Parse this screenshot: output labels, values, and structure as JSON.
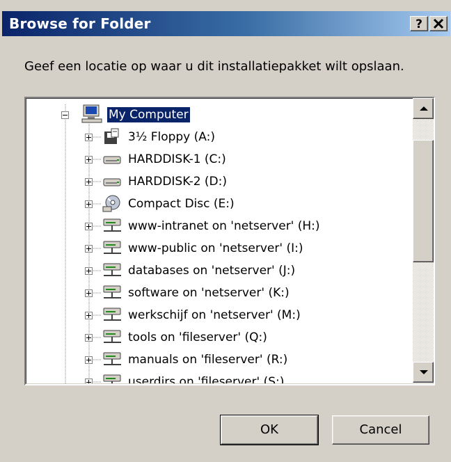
{
  "window": {
    "title": "Browse for Folder",
    "help_label": "?",
    "close_label": "close"
  },
  "instruction": "Geef een locatie op waar u dit installatiepakket wilt opslaan.",
  "tree": {
    "root": {
      "label": "My Computer",
      "icon": "my-computer-icon",
      "expanded": true,
      "selected": true
    },
    "items": [
      {
        "label": "3½ Floppy (A:)",
        "icon": "floppy-icon"
      },
      {
        "label": "HARDDISK-1 (C:)",
        "icon": "hard-drive-icon"
      },
      {
        "label": "HARDDISK-2 (D:)",
        "icon": "hard-drive-icon"
      },
      {
        "label": "Compact Disc (E:)",
        "icon": "cd-drive-icon"
      },
      {
        "label": "www-intranet on 'netserver' (H:)",
        "icon": "network-drive-icon"
      },
      {
        "label": "www-public on 'netserver' (I:)",
        "icon": "network-drive-icon"
      },
      {
        "label": "databases on 'netserver' (J:)",
        "icon": "network-drive-icon"
      },
      {
        "label": "software on 'netserver' (K:)",
        "icon": "network-drive-icon"
      },
      {
        "label": "werkschijf on 'netserver' (M:)",
        "icon": "network-drive-icon"
      },
      {
        "label": "tools on 'fileserver' (Q:)",
        "icon": "network-drive-icon"
      },
      {
        "label": "manuals on 'fileserver' (R:)",
        "icon": "network-drive-icon"
      },
      {
        "label": "userdirs on 'fileserver' (S:)",
        "icon": "network-drive-icon"
      }
    ]
  },
  "buttons": {
    "ok": "OK",
    "cancel": "Cancel"
  }
}
